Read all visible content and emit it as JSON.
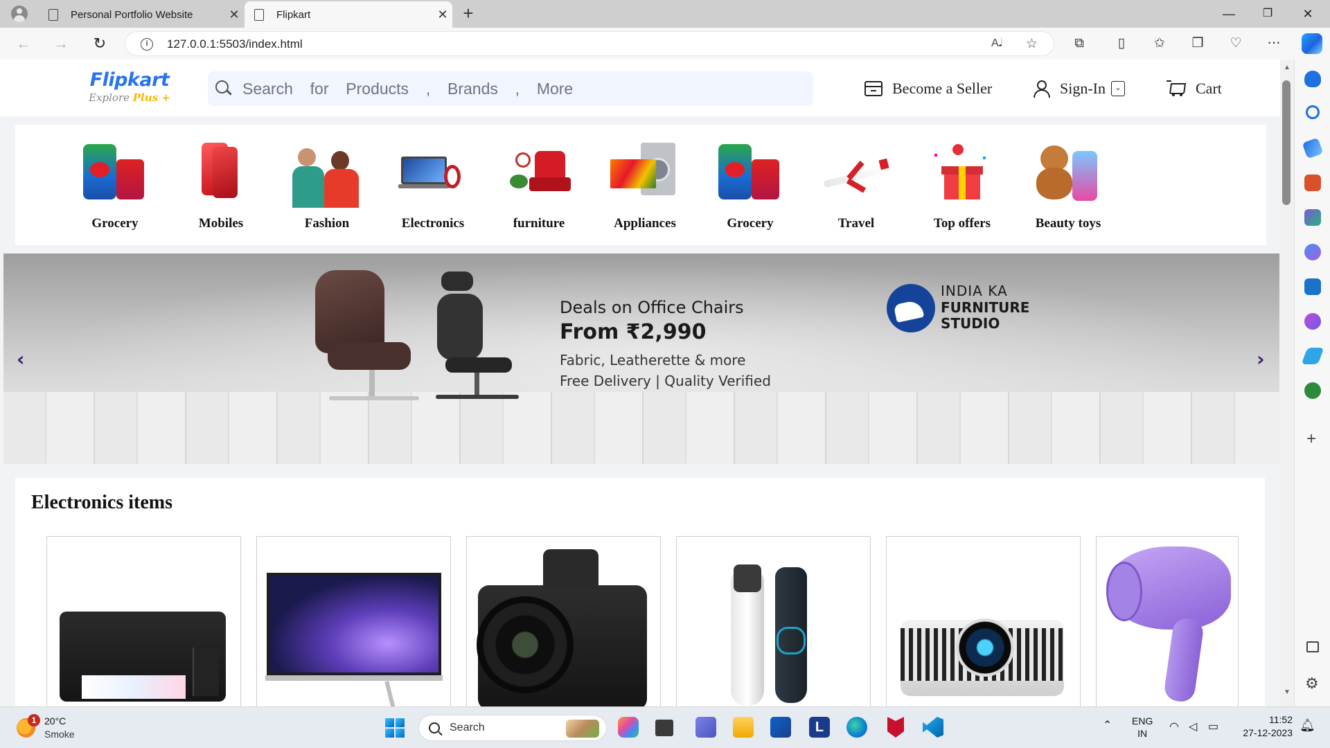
{
  "browser": {
    "tabs": [
      {
        "title": "Personal Portfolio Website",
        "active": false
      },
      {
        "title": "Flipkart",
        "active": true
      }
    ],
    "url": "127.0.0.1:5503/index.html"
  },
  "header": {
    "logo": {
      "brand": "Flipkart",
      "tagline": "Explore",
      "tagline_plus": "Plus"
    },
    "search_placeholder": "Search  for  Products  ,  Brands  ,  More",
    "become_seller": "Become a Seller",
    "sign_in": "Sign-In",
    "cart": "Cart"
  },
  "categories": [
    {
      "label": "Grocery",
      "icon": "grocery-icon"
    },
    {
      "label": "Mobiles",
      "icon": "mobile-icon"
    },
    {
      "label": "Fashion",
      "icon": "fashion-icon"
    },
    {
      "label": "Electronics",
      "icon": "electronics-icon"
    },
    {
      "label": "furniture",
      "icon": "furniture-icon"
    },
    {
      "label": "Appliances",
      "icon": "appliances-icon"
    },
    {
      "label": "Grocery",
      "icon": "grocery-icon"
    },
    {
      "label": "Travel",
      "icon": "airplane-icon"
    },
    {
      "label": "Top offers",
      "icon": "gift-icon"
    },
    {
      "label": "Beauty toys",
      "icon": "teddy-bear-icon"
    }
  ],
  "banner": {
    "line1": "Deals on Office Chairs",
    "line2": "From ₹2,990",
    "line3": "Fabric, Leatherette & more",
    "line4": "Free Delivery | Quality Verified",
    "studio_line1": "INDIA KA",
    "studio_line2": "FURNITURE",
    "studio_line3": "STUDIO",
    "prev": "‹",
    "next": "›"
  },
  "electronics": {
    "title": "Electronics items",
    "products": [
      "printer",
      "monitor",
      "camera",
      "trimmer",
      "projector",
      "hair-dryer"
    ]
  },
  "taskbar": {
    "weather_temp": "20°C",
    "weather_desc": "Smoke",
    "weather_badge": "1",
    "search": "Search",
    "lang1": "ENG",
    "lang2": "IN",
    "time": "11:52",
    "date": "27-12-2023"
  }
}
